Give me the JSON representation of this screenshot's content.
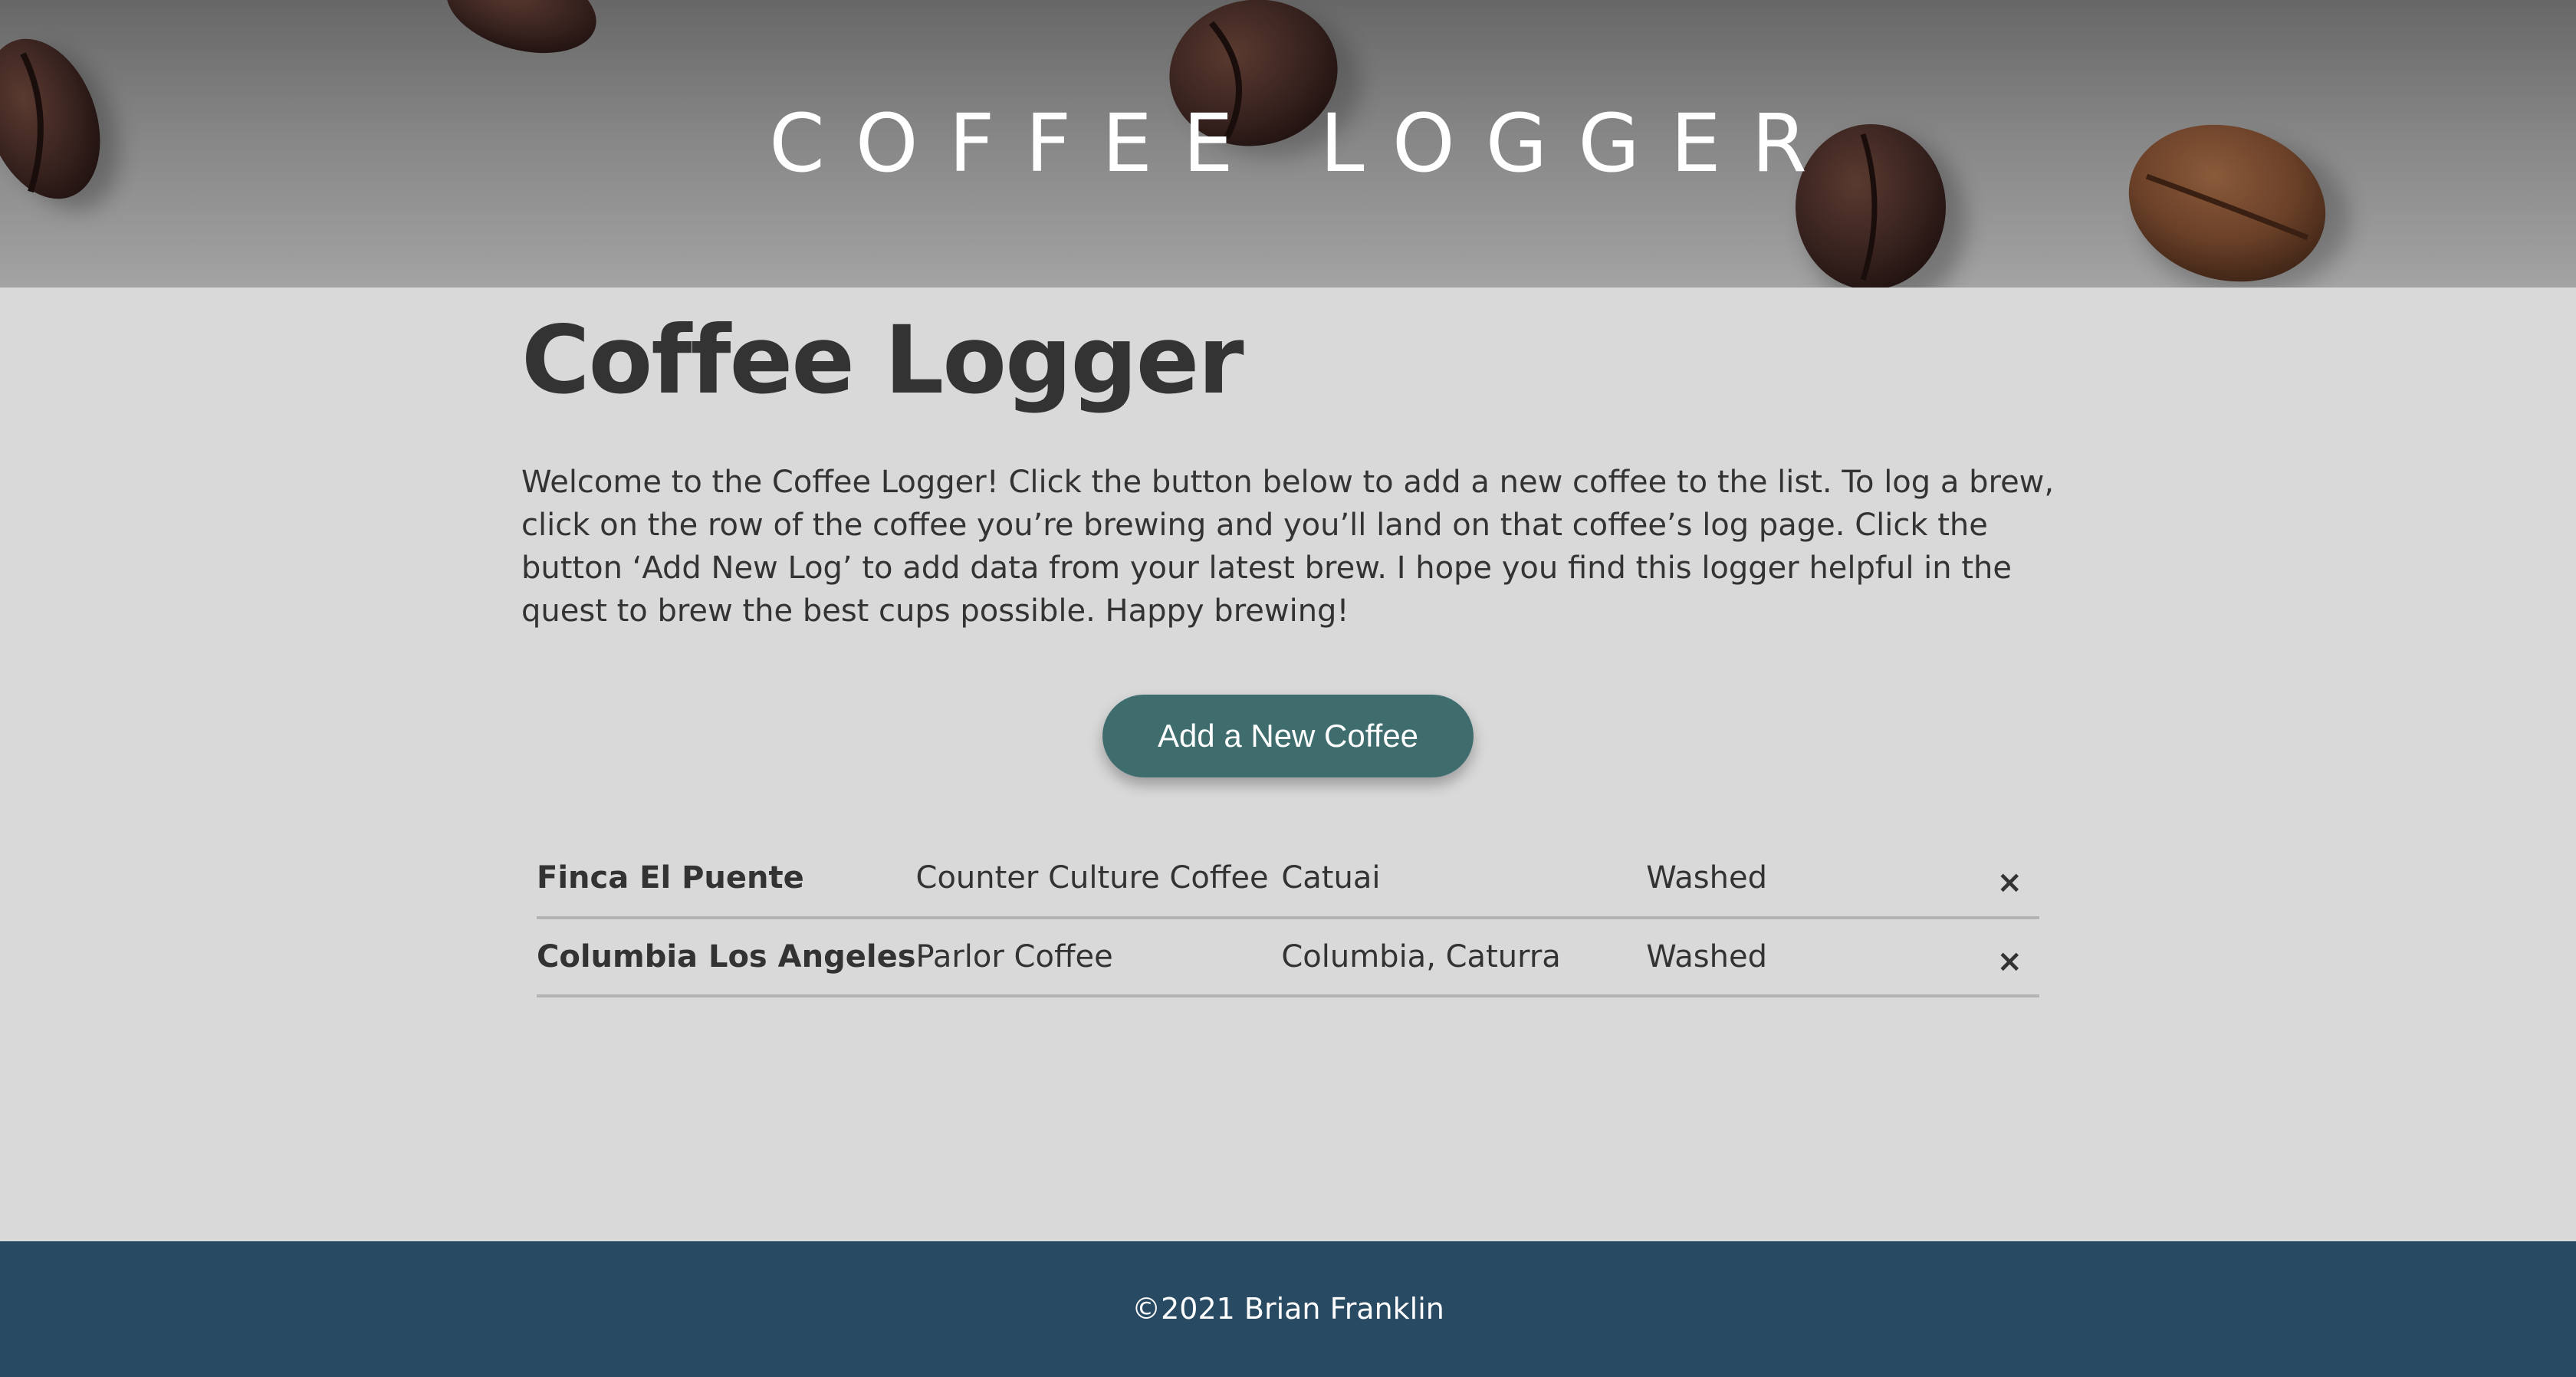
{
  "hero": {
    "title": "COFFEE LOGGER",
    "background_icon": "coffee-beans-photo"
  },
  "main": {
    "heading": "Coffee Logger",
    "intro": "Welcome to the Coffee Logger! Click the button below to add a new coffee to the list. To log a brew, click on the row of the coffee you’re brewing and you’ll land on that coffee’s log page. Click the button ‘Add New Log’ to add data from your latest brew. I hope you find this logger helpful in the quest to brew the best cups possible. Happy brewing!",
    "add_button_label": "Add a New Coffee"
  },
  "coffees": [
    {
      "name": "Finca El Puente",
      "roaster": "Counter Culture Coffee",
      "varietal": "Catuai",
      "process": "Washed",
      "delete_icon": "×"
    },
    {
      "name": "Columbia Los Angeles",
      "roaster": "Parlor Coffee",
      "varietal": "Columbia, Caturra",
      "process": "Washed",
      "delete_icon": "×"
    }
  ],
  "footer": {
    "copyright": "©2021 Brian Franklin"
  },
  "colors": {
    "page_background": "#d9d9d9",
    "text": "#333333",
    "button": "#3f6d6e",
    "footer": "#284a63",
    "row_divider": "#b3b3b3"
  }
}
